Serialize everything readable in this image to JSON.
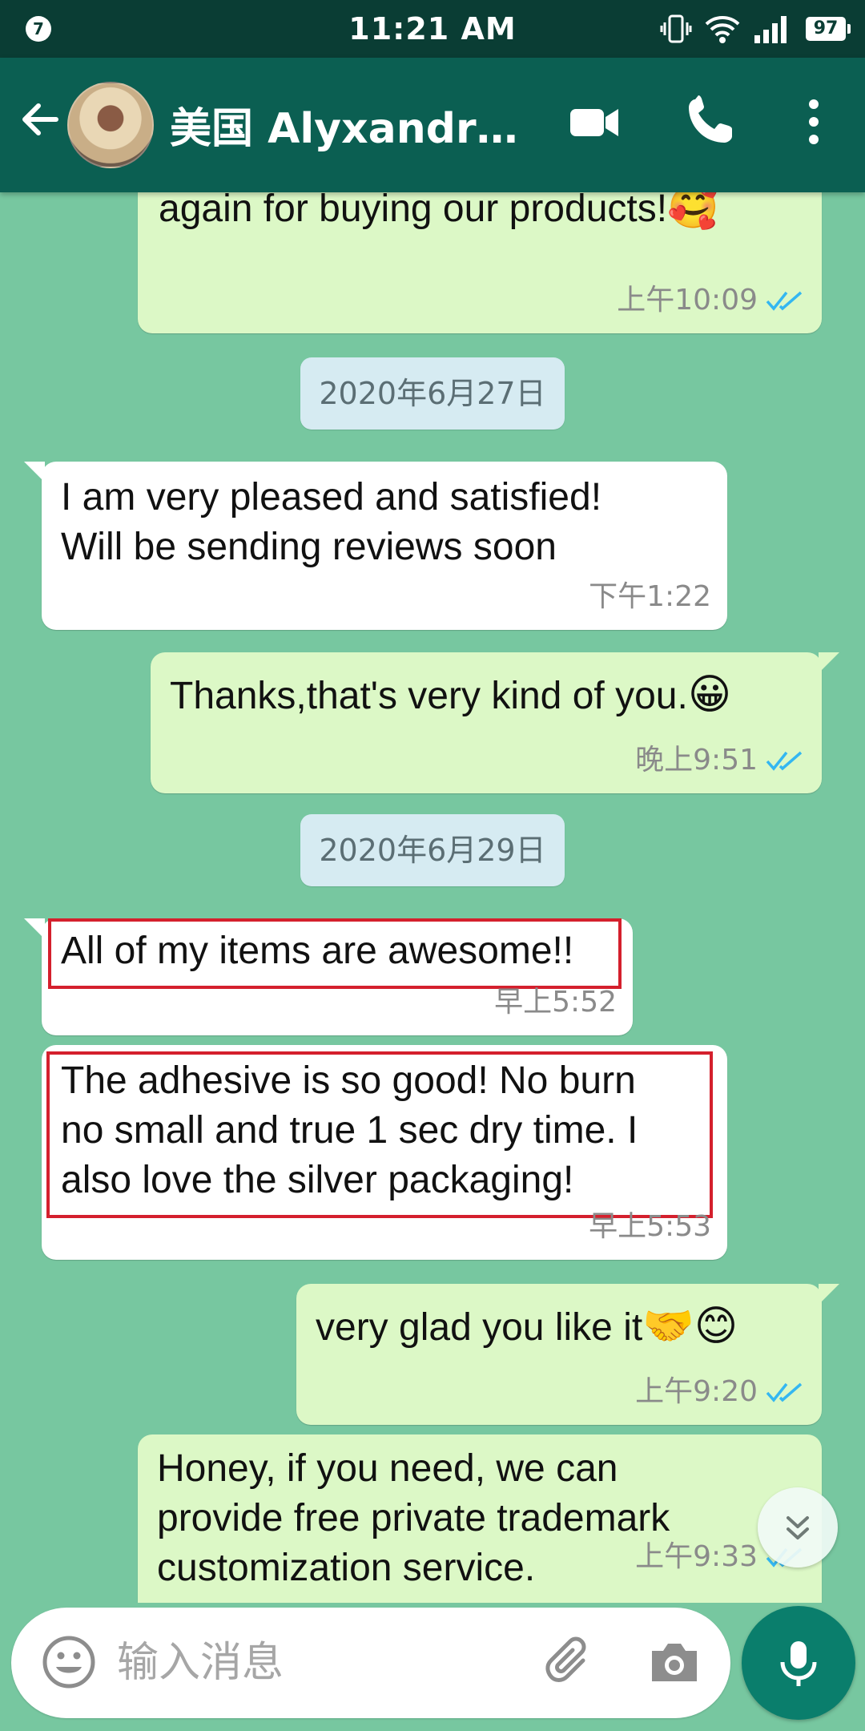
{
  "status_bar": {
    "notification_count": "7",
    "time": "11:21 AM",
    "battery": "97"
  },
  "header": {
    "contact_name": "美国 Alyxandra R..."
  },
  "messages": [
    {
      "dir": "out",
      "text": "We will improve it. Thank you\nagain for buying our products!",
      "emoji": "🥰",
      "time": "上午10:09",
      "read": true
    },
    {
      "dir": "date",
      "text": "2020年6月27日"
    },
    {
      "dir": "in",
      "text": "I am very pleased and satisfied!\nWill be sending reviews soon",
      "time": "下午1:22"
    },
    {
      "dir": "out",
      "text": "Thanks,that's very kind of you.",
      "emoji": "😀",
      "time": "晚上9:51",
      "read": true
    },
    {
      "dir": "date",
      "text": "2020年6月29日"
    },
    {
      "dir": "in",
      "text": "All of my items are awesome!!",
      "time": "早上5:52"
    },
    {
      "dir": "in",
      "text": "The adhesive is so good! No burn\nno small and true 1 sec dry time. I\nalso love the silver packaging!",
      "time": "早上5:53"
    },
    {
      "dir": "out",
      "text": "very glad you like it",
      "emoji": "🤝😊",
      "time": "上午9:20",
      "read": true
    },
    {
      "dir": "out",
      "text": "Honey, if you need, we can\nprovide free private trademark\ncustomization service.",
      "time": "上午9:33",
      "read": true
    }
  ],
  "input": {
    "placeholder": "输入消息"
  },
  "colors": {
    "header": "#0b5f52",
    "chat_background": "#77c7a0",
    "outgoing_bubble": "#dcf8c6",
    "incoming_bubble": "#ffffff",
    "read_ticks": "#34b7f1",
    "highlight_border": "#d4202d",
    "mic_button": "#0a7e6c"
  },
  "icons": [
    "back-arrow-icon",
    "video-call-icon",
    "phone-icon",
    "more-vert-icon",
    "emoji-icon",
    "attach-icon",
    "camera-icon",
    "mic-icon",
    "scroll-down-icon",
    "read-ticks-icon"
  ]
}
